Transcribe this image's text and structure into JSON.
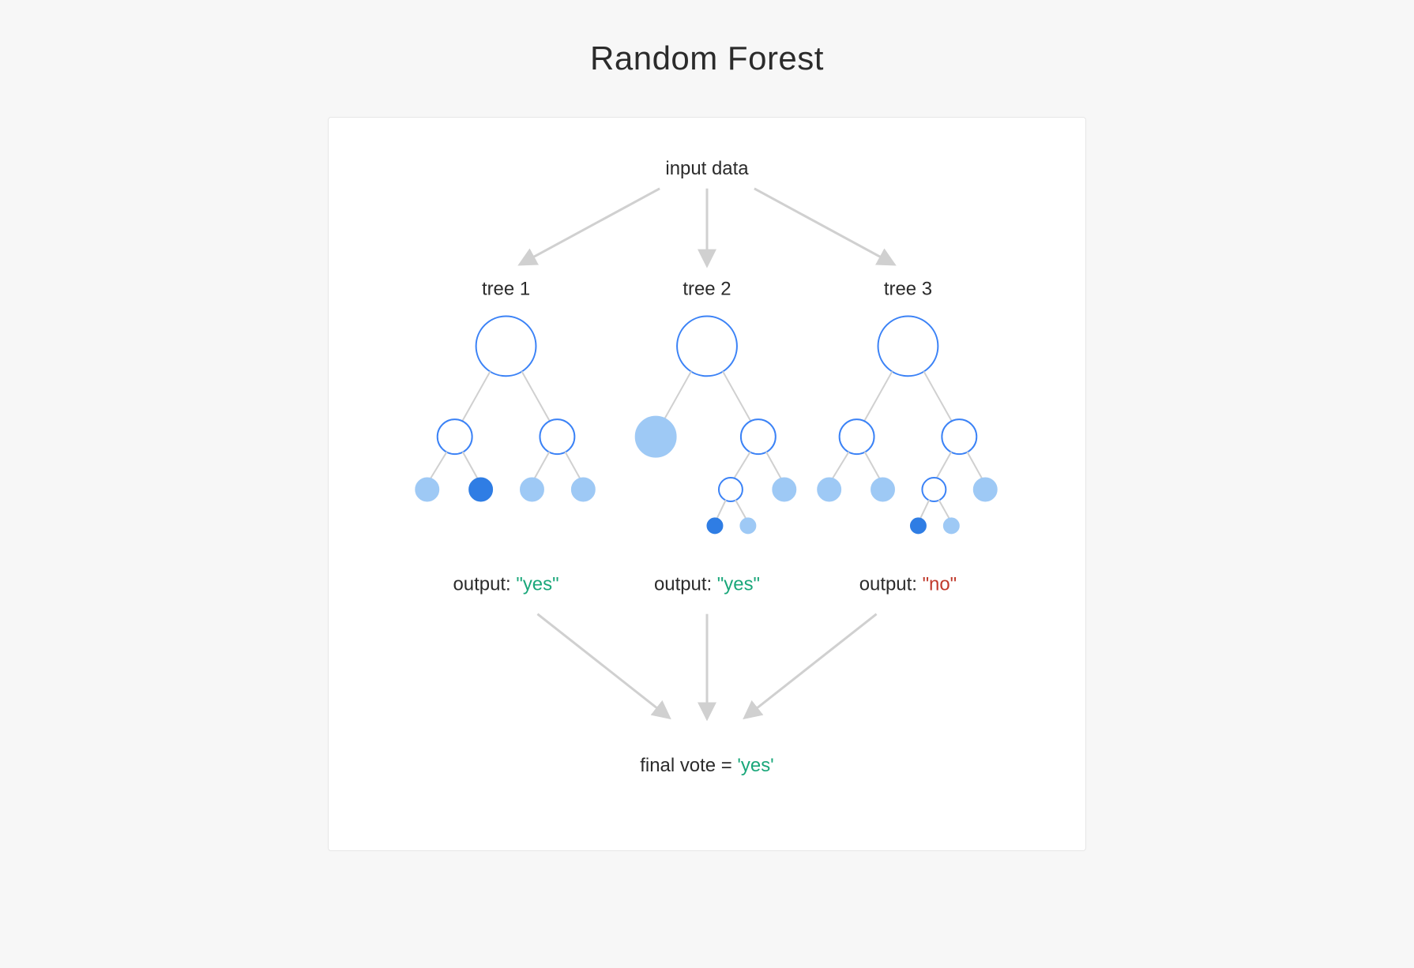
{
  "title": "Random Forest",
  "input_label": "input data",
  "trees": [
    {
      "label": "tree 1",
      "output_prefix": "output: ",
      "output_value": "\"yes\"",
      "output_class": "yes"
    },
    {
      "label": "tree 2",
      "output_prefix": "output: ",
      "output_value": "\"yes\"",
      "output_class": "yes"
    },
    {
      "label": "tree 3",
      "output_prefix": "output: ",
      "output_value": "\"no\"",
      "output_class": "no"
    }
  ],
  "final_prefix": "final vote = ",
  "final_value": "'yes'",
  "final_class": "yes",
  "colors": {
    "yes": "#1aa77a",
    "no": "#c0392b",
    "node_stroke": "#3b82f6",
    "node_light": "#9ec9f5",
    "node_dark": "#2f7de4",
    "arrow": "#d0d0d0",
    "bg": "#f7f7f7"
  }
}
